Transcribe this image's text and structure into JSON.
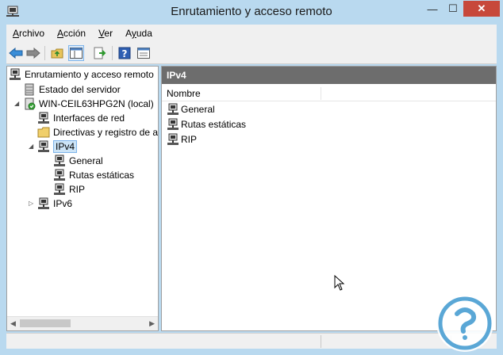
{
  "window": {
    "title": "Enrutamiento y acceso remoto",
    "controls": {
      "minimize": "—",
      "maximize": "☐",
      "close": "✕"
    }
  },
  "menu": {
    "items": [
      {
        "label": "Archivo",
        "accel": "A",
        "rest": "rchivo"
      },
      {
        "label": "Acción",
        "accel": "A",
        "rest": "cción"
      },
      {
        "label": "Ver",
        "accel": "V",
        "rest": "er"
      },
      {
        "label": "Ayuda",
        "accel": "y",
        "pre": "A",
        "rest": "uda"
      }
    ]
  },
  "toolbar": {
    "buttons": [
      "back-icon",
      "forward-icon",
      "up-folder-icon",
      "show-hide-tree-icon",
      "export-list-icon",
      "help-icon",
      "properties-icon"
    ]
  },
  "tree": {
    "items": [
      {
        "label": "Enrutamiento y acceso remoto",
        "icon": "routing-icon"
      },
      {
        "label": "Estado del servidor",
        "icon": "server-status-icon"
      },
      {
        "label": "WIN-CEIL63HPG2N (local)",
        "icon": "server-icon"
      },
      {
        "label": "Interfaces de red",
        "icon": "network-interfaces-icon"
      },
      {
        "label": "Directivas y registro de a",
        "icon": "folder-icon"
      },
      {
        "label": "IPv4",
        "icon": "routing-icon"
      },
      {
        "label": "General",
        "icon": "routing-icon"
      },
      {
        "label": "Rutas estáticas",
        "icon": "routing-icon"
      },
      {
        "label": "RIP",
        "icon": "routing-icon"
      },
      {
        "label": "IPv6",
        "icon": "routing-icon"
      }
    ]
  },
  "details": {
    "header": "IPv4",
    "column": "Nombre",
    "rows": [
      {
        "label": "General",
        "icon": "routing-icon"
      },
      {
        "label": "Rutas estáticas",
        "icon": "routing-icon"
      },
      {
        "label": "RIP",
        "icon": "routing-icon"
      }
    ]
  },
  "colors": {
    "accent_close": "#c7483b",
    "frame": "#b9d9ef",
    "selection": "#cce4f7",
    "header_bar": "#6d6d6d"
  }
}
